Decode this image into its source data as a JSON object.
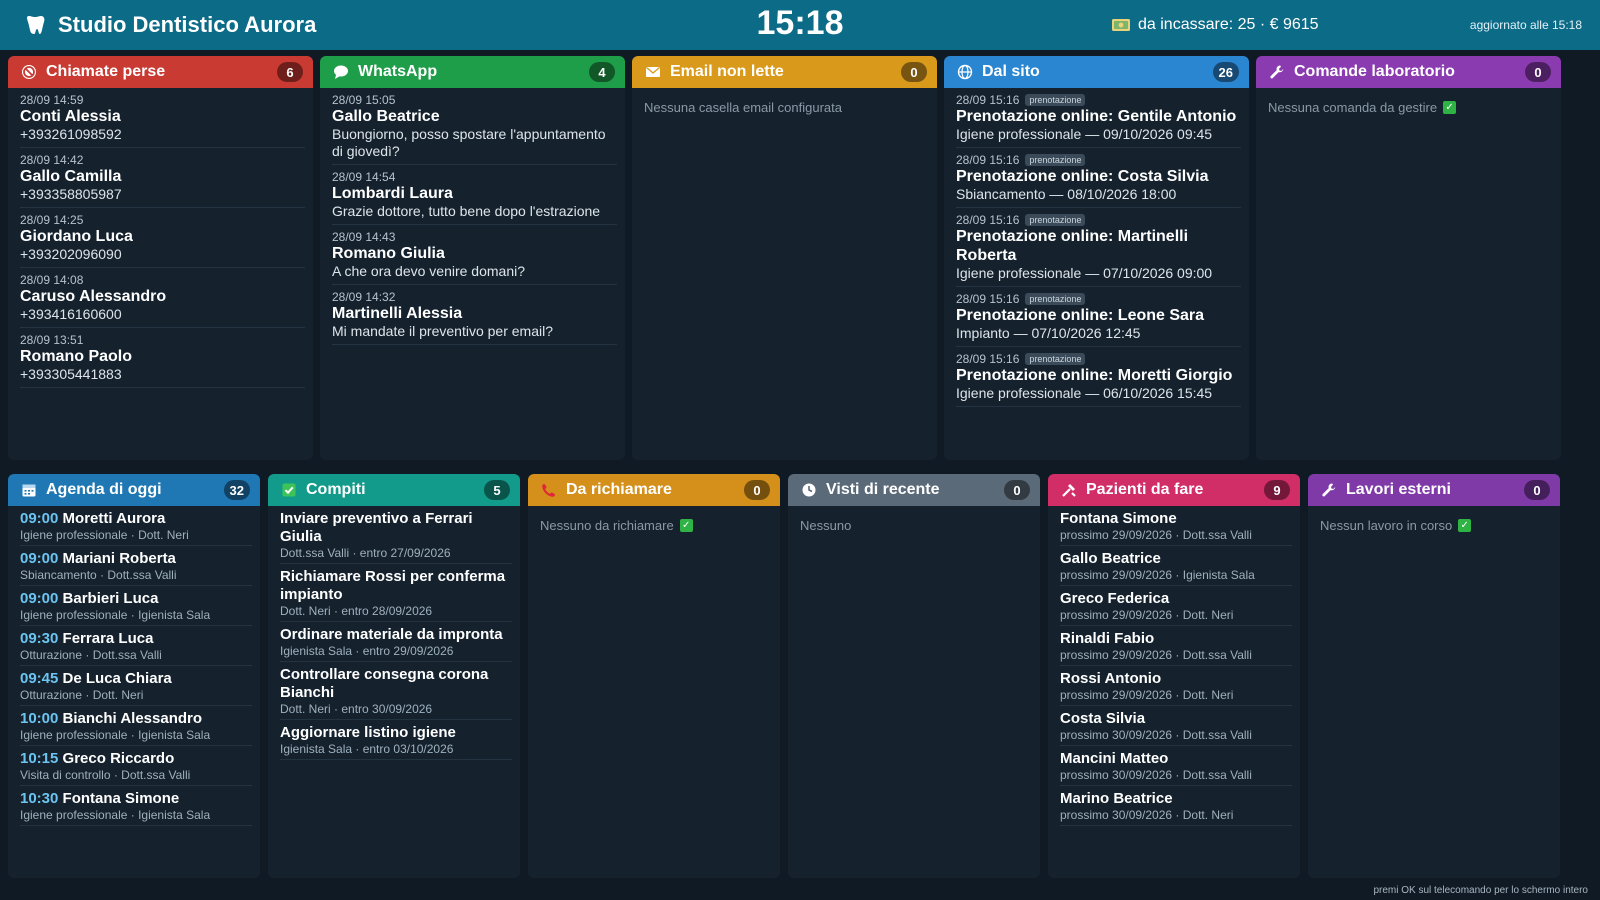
{
  "header": {
    "title": "Studio Dentistico Aurora",
    "clock": "15:18",
    "incassare": "da incassare: 25 · € 9615",
    "updated": "aggiornato alle 15:18",
    "logo_icon": "tooth-icon",
    "incassare_icon": "money-icon"
  },
  "colors": {
    "topbar": "#0c6b87",
    "chiamate": "#c93a32",
    "whatsapp": "#1f9e4a",
    "email": "#d99a1c",
    "sito": "#2a86d1",
    "laboratorio": "#8a3bb0",
    "agenda": "#1f78b4",
    "compiti": "#129b8a",
    "richiamare": "#d4901a",
    "visti": "#5b6a79",
    "pazienti": "#d12d66",
    "lavori": "#7f3aa8"
  },
  "chiamate": {
    "title": "Chiamate perse",
    "count": "6",
    "items": [
      {
        "ts": "28/09 14:59",
        "name": "Conti Alessia",
        "sub": "+393261098592"
      },
      {
        "ts": "28/09 14:42",
        "name": "Gallo Camilla",
        "sub": "+393358805987"
      },
      {
        "ts": "28/09 14:25",
        "name": "Giordano Luca",
        "sub": "+393202096090"
      },
      {
        "ts": "28/09 14:08",
        "name": "Caruso Alessandro",
        "sub": "+393416160600"
      },
      {
        "ts": "28/09 13:51",
        "name": "Romano Paolo",
        "sub": "+393305441883"
      }
    ]
  },
  "whatsapp": {
    "title": "WhatsApp",
    "count": "4",
    "items": [
      {
        "ts": "28/09 15:05",
        "name": "Gallo Beatrice",
        "sub": "Buongiorno, posso spostare l'appuntamento di giovedì?"
      },
      {
        "ts": "28/09 14:54",
        "name": "Lombardi Laura",
        "sub": "Grazie dottore, tutto bene dopo l'estrazione"
      },
      {
        "ts": "28/09 14:43",
        "name": "Romano Giulia",
        "sub": "A che ora devo venire domani?"
      },
      {
        "ts": "28/09 14:32",
        "name": "Martinelli Alessia",
        "sub": "Mi mandate il preventivo per email?"
      }
    ]
  },
  "email": {
    "title": "Email non lette",
    "count": "0",
    "empty": "Nessuna casella email configurata"
  },
  "sito": {
    "title": "Dal sito",
    "count": "26",
    "items": [
      {
        "ts": "28/09 15:16",
        "tag": "prenotazione",
        "name": "Prenotazione online: Gentile Antonio",
        "sub": "Igiene professionale — 09/10/2026 09:45"
      },
      {
        "ts": "28/09 15:16",
        "tag": "prenotazione",
        "name": "Prenotazione online: Costa Silvia",
        "sub": "Sbiancamento — 08/10/2026 18:00"
      },
      {
        "ts": "28/09 15:16",
        "tag": "prenotazione",
        "name": "Prenotazione online: Martinelli Roberta",
        "sub": "Igiene professionale — 07/10/2026 09:00"
      },
      {
        "ts": "28/09 15:16",
        "tag": "prenotazione",
        "name": "Prenotazione online: Leone Sara",
        "sub": "Impianto — 07/10/2026 12:45"
      },
      {
        "ts": "28/09 15:16",
        "tag": "prenotazione",
        "name": "Prenotazione online: Moretti Giorgio",
        "sub": "Igiene professionale — 06/10/2026 15:45"
      }
    ]
  },
  "laboratorio": {
    "title": "Comande laboratorio",
    "count": "0",
    "empty": "Nessuna comanda da gestire"
  },
  "agenda": {
    "title": "Agenda di oggi",
    "count": "32",
    "items": [
      {
        "time": "09:00",
        "name": "Moretti Aurora",
        "meta": "Igiene professionale · Dott. Neri"
      },
      {
        "time": "09:00",
        "name": "Mariani Roberta",
        "meta": "Sbiancamento · Dott.ssa Valli"
      },
      {
        "time": "09:00",
        "name": "Barbieri Luca",
        "meta": "Igiene professionale · Igienista Sala"
      },
      {
        "time": "09:30",
        "name": "Ferrara Luca",
        "meta": "Otturazione · Dott.ssa Valli"
      },
      {
        "time": "09:45",
        "name": "De Luca Chiara",
        "meta": "Otturazione · Dott. Neri"
      },
      {
        "time": "10:00",
        "name": "Bianchi Alessandro",
        "meta": "Igiene professionale · Igienista Sala"
      },
      {
        "time": "10:15",
        "name": "Greco Riccardo",
        "meta": "Visita di controllo · Dott.ssa Valli"
      },
      {
        "time": "10:30",
        "name": "Fontana Simone",
        "meta": "Igiene professionale · Igienista Sala"
      }
    ]
  },
  "compiti": {
    "title": "Compiti",
    "count": "5",
    "items": [
      {
        "name": "Inviare preventivo a Ferrari Giulia",
        "meta": "Dott.ssa Valli · entro 27/09/2026"
      },
      {
        "name": "Richiamare Rossi per conferma impianto",
        "meta": "Dott. Neri · entro 28/09/2026"
      },
      {
        "name": "Ordinare materiale da impronta",
        "meta": "Igienista Sala · entro 29/09/2026"
      },
      {
        "name": "Controllare consegna corona Bianchi",
        "meta": "Dott. Neri · entro 30/09/2026"
      },
      {
        "name": "Aggiornare listino igiene",
        "meta": "Igienista Sala · entro 03/10/2026"
      }
    ]
  },
  "richiamare": {
    "title": "Da richiamare",
    "count": "0",
    "empty": "Nessuno da richiamare"
  },
  "visti": {
    "title": "Visti di recente",
    "count": "0",
    "empty": "Nessuno"
  },
  "pazienti": {
    "title": "Pazienti da fare",
    "count": "9",
    "items": [
      {
        "name": "Fontana Simone",
        "meta": "prossimo 29/09/2026 · Dott.ssa Valli"
      },
      {
        "name": "Gallo Beatrice",
        "meta": "prossimo 29/09/2026 · Igienista Sala"
      },
      {
        "name": "Greco Federica",
        "meta": "prossimo 29/09/2026 · Dott. Neri"
      },
      {
        "name": "Rinaldi Fabio",
        "meta": "prossimo 29/09/2026 · Dott.ssa Valli"
      },
      {
        "name": "Rossi Antonio",
        "meta": "prossimo 29/09/2026 · Dott. Neri"
      },
      {
        "name": "Costa Silvia",
        "meta": "prossimo 30/09/2026 · Dott.ssa Valli"
      },
      {
        "name": "Mancini Matteo",
        "meta": "prossimo 30/09/2026 · Dott.ssa Valli"
      },
      {
        "name": "Marino Beatrice",
        "meta": "prossimo 30/09/2026 · Dott. Neri"
      }
    ]
  },
  "lavori": {
    "title": "Lavori esterni",
    "count": "0",
    "empty": "Nessun lavoro in corso"
  },
  "footer": {
    "note": "premi OK sul telecomando per lo schermo intero"
  }
}
